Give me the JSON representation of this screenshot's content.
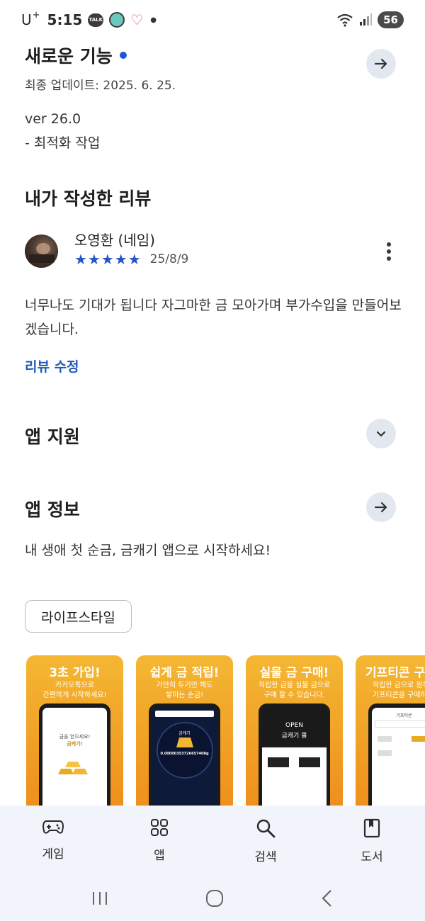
{
  "status_bar": {
    "carrier": "U",
    "carrier_sup": "+",
    "time": "5:15",
    "talk_badge": "TALK",
    "battery": "56"
  },
  "whats_new": {
    "title": "새로운 기능",
    "updated": "최종 업데이트: 2025. 6. 25.",
    "version": "ver 26.0",
    "note": "- 최적화 작업"
  },
  "my_review": {
    "heading": "내가 작성한 리뷰",
    "author": "오영환 (네임)",
    "stars": "★★★★★",
    "rating": 5,
    "date": "25/8/9",
    "text": "너무나도 기대가 됩니다 자그마한 금 모아가며 부가수입을 만들어보겠습니다.",
    "edit_link": "리뷰 수정"
  },
  "app_support": {
    "heading": "앱 지원"
  },
  "app_info": {
    "heading": "앱 정보",
    "description": "내 생애 첫 순금, 금캐기 앱으로 시작하세요!",
    "category_chip": "라이프스타일"
  },
  "screenshots": [
    {
      "title": "3초 가입!",
      "sub1": "카카오톡으로",
      "sub2": "간편하게 시작하세요!",
      "screen_text1": "금을 얻으세요!",
      "screen_text2": "금캐기!"
    },
    {
      "title": "쉽게 금 적립!",
      "sub1": "가만히 두기만 해도",
      "sub2": "쌓이는 순금!",
      "screen_text1": "금캐기",
      "screen_text2": "0.00000353726657408g"
    },
    {
      "title": "실물 금 구매!",
      "sub1": "적립한 금을 실물 금으로",
      "sub2": "구매 할 수 있습니다.",
      "screen_text1": "OPEN",
      "screen_text2": "금캐기 몰"
    },
    {
      "title": "기프티콘 구",
      "sub1": "적립한 금으로 원하",
      "sub2": "기프티콘을 구매하",
      "screen_text1": "기프티콘",
      "screen_text2": ""
    }
  ],
  "bottom_nav": [
    {
      "label": "게임",
      "icon": "gamepad-icon"
    },
    {
      "label": "앱",
      "icon": "apps-grid-icon"
    },
    {
      "label": "검색",
      "icon": "search-icon"
    },
    {
      "label": "도서",
      "icon": "book-icon"
    }
  ],
  "colors": {
    "accent_blue": "#1f5bb8",
    "star_blue": "#2455c8",
    "round_button_bg": "#e3e8f0",
    "nav_bg": "#f1f4fa",
    "screenshot_orange": "#f4a52a"
  }
}
